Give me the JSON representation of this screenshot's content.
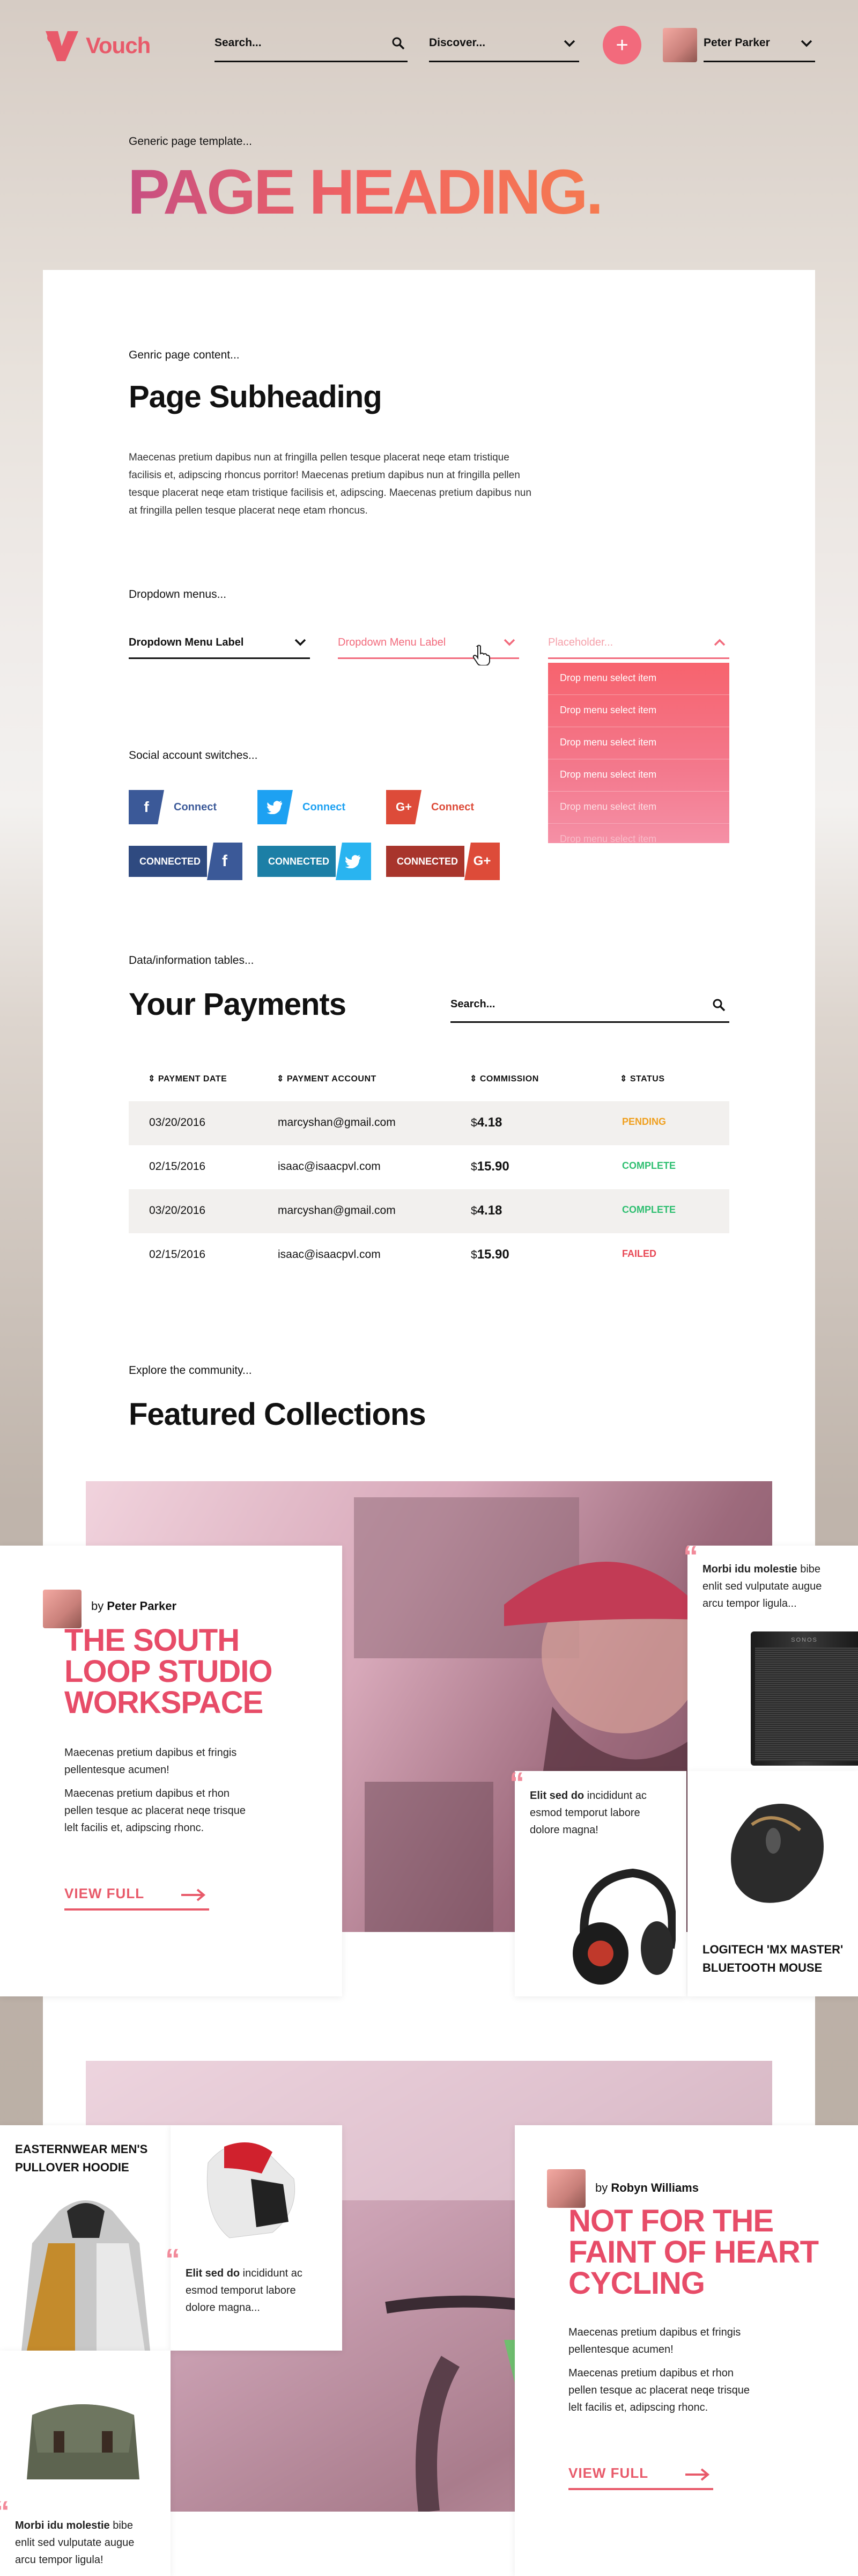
{
  "header": {
    "brand": "Vouch",
    "search_placeholder": "Search...",
    "discover_label": "Discover...",
    "user_name": "Peter Parker"
  },
  "page": {
    "eyebrow": "Generic page template...",
    "heading": "PAGE HEADING."
  },
  "content": {
    "eyebrow": "Genric page content...",
    "subheading": "Page Subheading",
    "body_lines": [
      "Maecenas pretium dapibus nun at fringilla pellen tesque placerat neqe etam tristique",
      "facilisis et, adipscing rhoncus porritor! Maecenas pretium dapibus nun at fringilla pellen",
      "tesque placerat neqe etam tristique facilisis et, adipscing. Maecenas pretium dapibus nun",
      "at fringilla pellen tesque placerat neqe etam rhoncus."
    ]
  },
  "dropdowns": {
    "eyebrow": "Dropdown menus...",
    "dd1_label": "Dropdown Menu Label",
    "dd2_label": "Dropdown Menu Label",
    "dd3_placeholder": "Placeholder...",
    "menu_items": [
      "Drop menu select item",
      "Drop menu select item",
      "Drop menu select item",
      "Drop menu select item",
      "Drop menu select item",
      "Drop menu select item"
    ]
  },
  "social": {
    "eyebrow": "Social account switches...",
    "connect_label": "Connect",
    "connected_label": "CONNECTED",
    "colors": {
      "facebook": "#3b5998",
      "twitter": "#1da1f2",
      "google": "#dd4b39"
    }
  },
  "payments": {
    "eyebrow": "Data/information tables...",
    "title": "Your Payments",
    "search_placeholder": "Search...",
    "columns": [
      "PAYMENT DATE",
      "PAYMENT ACCOUNT",
      "COMMISSION",
      "STATUS"
    ],
    "rows": [
      {
        "date": "03/20/2016",
        "account": "marcyshan@gmail.com",
        "currency": "$",
        "amount": "4.18",
        "status": "PENDING",
        "status_color": "#f0a020"
      },
      {
        "date": "02/15/2016",
        "account": "isaac@isaacpvl.com",
        "currency": "$",
        "amount": "15.90",
        "status": "COMPLETE",
        "status_color": "#2fbf71"
      },
      {
        "date": "03/20/2016",
        "account": "marcyshan@gmail.com",
        "currency": "$",
        "amount": "4.18",
        "status": "COMPLETE",
        "status_color": "#2fbf71"
      },
      {
        "date": "02/15/2016",
        "account": "isaac@isaacpvl.com",
        "currency": "$",
        "amount": "15.90",
        "status": "FAILED",
        "status_color": "#e84855"
      }
    ]
  },
  "community": {
    "eyebrow": "Explore the community...",
    "title": "Featured Collections"
  },
  "collection1": {
    "by": "by",
    "author": "Peter Parker",
    "title_lines": [
      "THE SOUTH",
      "LOOP STUDIO",
      "WORKSPACE"
    ],
    "desc1": [
      "Maecenas pretium dapibus et fringis",
      "pellentesque acumen!"
    ],
    "desc2": [
      "Maecenas pretium dapibus et rhon",
      "pellen tesque ac placerat neqe trisque",
      "lelt facilis et, adipscing rhonc."
    ],
    "cta": "VIEW FULL",
    "quote_top": {
      "bold": "Morbi idu molestie",
      "rest_lines": [
        " bibe",
        "enlit sed vulputate augue",
        "arcu tempor ligula..."
      ]
    },
    "quote_mid": {
      "bold": "Elit sed do",
      "rest_lines": [
        " incididunt ac",
        "esmod temporut labore",
        "dolore magna!"
      ]
    },
    "speaker_brand": "SONOS",
    "product_title": [
      "LOGITECH 'MX MASTER'",
      "BLUETOOTH MOUSE"
    ]
  },
  "collection2": {
    "by": "by",
    "author": "Robyn Williams",
    "title_lines": [
      "NOT FOR THE",
      "FAINT OF HEART",
      "CYCLING"
    ],
    "desc1": [
      "Maecenas pretium dapibus et fringis",
      "pellentesque acumen!"
    ],
    "desc2": [
      "Maecenas pretium dapibus et rhon",
      "pellen tesque ac placerat neqe trisque",
      "lelt facilis et, adipscing rhonc."
    ],
    "cta": "VIEW FULL",
    "product_title": [
      "EASTERNWEAR MEN'S",
      "PULLOVER HOODIE"
    ],
    "quote_mid": {
      "bold": "Elit sed do",
      "rest_lines": [
        " incididunt ac",
        "esmod temporut labore",
        "dolore magna..."
      ]
    },
    "quote_bottom": {
      "bold": "Morbi idu molestie",
      "rest_lines": [
        " bibe",
        "enlit sed vulputate augue",
        "arcu tempor ligula!"
      ]
    }
  }
}
